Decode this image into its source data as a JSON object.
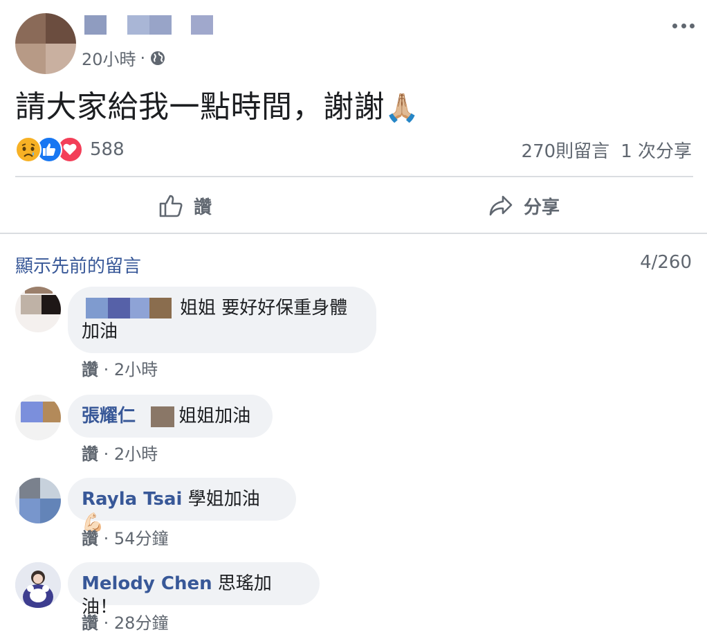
{
  "post": {
    "time": "20小時",
    "separator": "·",
    "text": "請大家給我一點時間，謝謝",
    "emoji": "🙏🏼",
    "reaction_count": "588",
    "comment_count": "270則留言",
    "share_count": "1 次分享"
  },
  "icons": {
    "privacy": "globe-icon",
    "more": "more-options-icon",
    "reactions": [
      "sad-reaction-icon",
      "like-reaction-icon",
      "love-reaction-icon"
    ],
    "like": "thumbs-up-icon",
    "share": "share-arrow-icon"
  },
  "actions": {
    "like_label": "讚",
    "share_label": "分享"
  },
  "comments_section": {
    "show_previous": "顯示先前的留言",
    "count": "4/260",
    "items": [
      {
        "author": "",
        "text_line1": "姐姐 要好好保重身體",
        "text_line2": "加油",
        "like": "讚",
        "time": "2小時"
      },
      {
        "author": "張耀仁",
        "text": "姐姐加油",
        "like": "讚",
        "time": "2小時"
      },
      {
        "author": "Rayla Tsai",
        "text": "學姐加油",
        "emoji": "💪🏻",
        "like": "讚",
        "time": "54分鐘"
      },
      {
        "author": "Melody Chen",
        "text": "思瑤加油！",
        "like": "讚",
        "time": "28分鐘"
      }
    ]
  },
  "colors": {
    "link_blue": "#385898",
    "meta_gray": "#606770",
    "bubble_bg": "#f0f2f5",
    "divider": "#dadde1",
    "like_blue": "#1877f2",
    "love_red": "#f33e58",
    "sad_yellow": "#f7b125"
  }
}
